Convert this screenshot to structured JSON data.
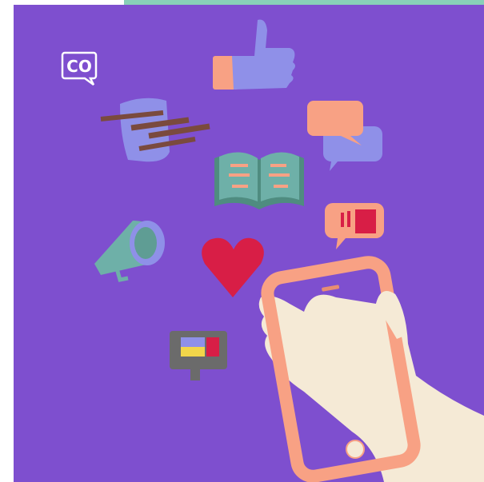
{
  "logo": {
    "text": "CO"
  },
  "icons": [
    "thumbs-up-icon",
    "chat-bubbles-icon",
    "paper-notes-icon",
    "open-book-icon",
    "comment-icon",
    "megaphone-icon",
    "heart-icon",
    "monitor-icon",
    "hand-holding-phone-icon"
  ],
  "colors": {
    "background": "#7e4fcf",
    "banner": "#88d0b8",
    "periwinkle": "#8f90e8",
    "salmon": "#f8a184",
    "red": "#d81e46",
    "teal": "#6eb0a8",
    "cream": "#f5ead6",
    "gray": "#6b6b6b",
    "brown": "#7a4a3e",
    "yellow": "#f2d64a"
  }
}
